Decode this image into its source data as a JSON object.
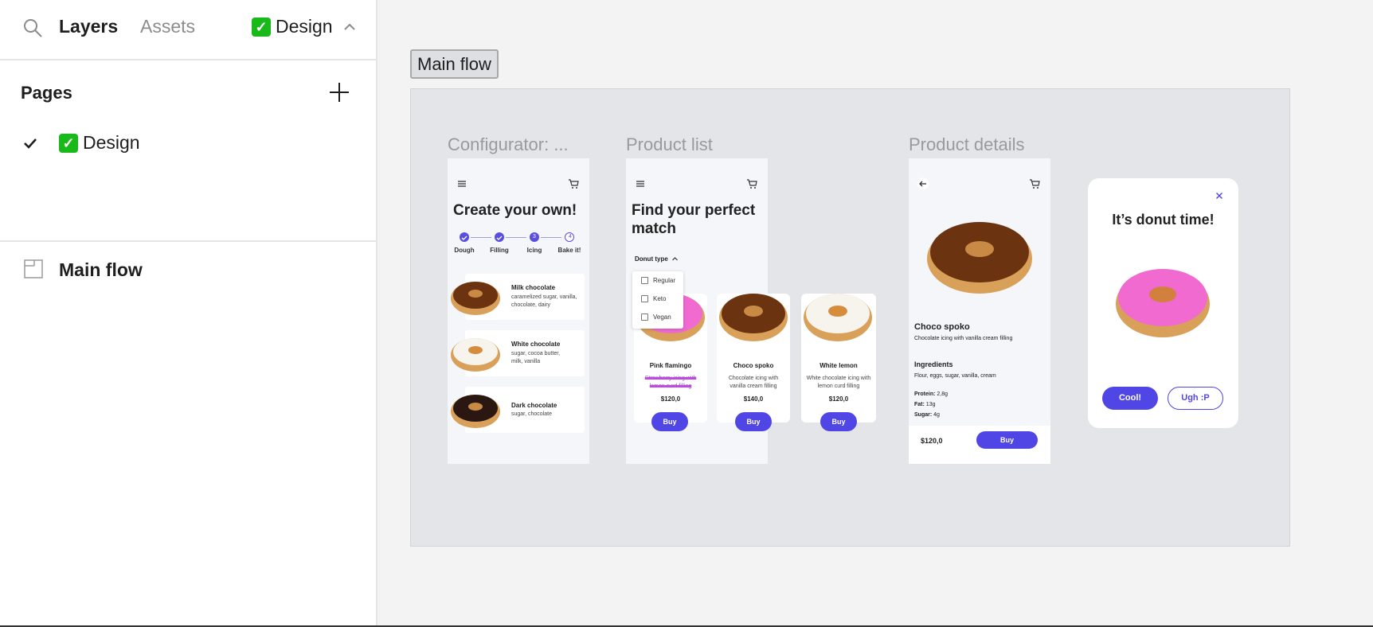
{
  "sidebar": {
    "tabs": {
      "layers": "Layers",
      "assets": "Assets"
    },
    "page_switcher": {
      "emoji": "✓",
      "label": "Design"
    },
    "pages": {
      "title": "Pages",
      "items": [
        {
          "emoji": "✓",
          "label": "Design",
          "selected": true
        }
      ]
    },
    "layers": [
      {
        "label": "Main flow",
        "type": "frame"
      }
    ]
  },
  "canvas": {
    "section_label": "Main flow",
    "frames": {
      "configurator": {
        "label": "Configurator: ...",
        "heading": "Create your own!",
        "steps": [
          {
            "label": "Dough",
            "state": "done"
          },
          {
            "label": "Filling",
            "state": "done"
          },
          {
            "label": "Icing",
            "state": "current",
            "num": "3"
          },
          {
            "label": "Bake it!",
            "state": "todo",
            "num": "4"
          }
        ],
        "options": [
          {
            "title": "Milk chocolate",
            "sub": "caramelized sugar, vanilla, chocolate, dairy"
          },
          {
            "title": "White chocolate",
            "sub": "sugar, cocoa butter, milk, vanilla"
          },
          {
            "title": "Dark chocolate",
            "sub": "sugar, chocolate"
          }
        ]
      },
      "product_list": {
        "label": "Product list",
        "heading": "Find your perfect match",
        "filter_label": "Donut type",
        "filter_options": [
          "Regular",
          "Keto",
          "Vegan"
        ],
        "products": [
          {
            "name": "Pink flamingo",
            "desc": "Strawberry icing with lemon curd filling",
            "price": "$120,0",
            "buy": "Buy"
          },
          {
            "name": "Choco spoko",
            "desc": "Chocolate icing with vanilla cream filling",
            "price": "$140,0",
            "buy": "Buy"
          },
          {
            "name": "White lemon",
            "desc": "White chocolate icing with lemon curd filling",
            "price": "$120,0",
            "buy": "Buy"
          }
        ]
      },
      "product_details": {
        "label": "Product details",
        "name": "Choco spoko",
        "desc": "Chocolate icing with vanilla cream filling",
        "ingredients_title": "Ingredients",
        "ingredients": "Flour, eggs, sugar, vanilla, cream",
        "nutrition": [
          {
            "label": "Protein:",
            "value": "2,8g"
          },
          {
            "label": "Fat:",
            "value": "13g"
          },
          {
            "label": "Sugar:",
            "value": "4g"
          }
        ],
        "price": "$120,0",
        "buy": "Buy"
      },
      "dialog": {
        "title": "It’s donut time!",
        "confirm": "Cool!",
        "dismiss": "Ugh :P"
      }
    }
  },
  "colors": {
    "accent": "#5046e5",
    "pink_icing": "#f06ad0",
    "chocolate": "#6b3310",
    "dark_chocolate": "#2a1712",
    "white_icing": "#f7f4ee",
    "dough": "#d9a05a"
  },
  "icons": [
    "search-icon",
    "chevron-up-icon",
    "plus-icon",
    "check-icon",
    "frame-icon",
    "menu-icon",
    "cart-icon",
    "back-arrow-icon",
    "close-icon"
  ]
}
